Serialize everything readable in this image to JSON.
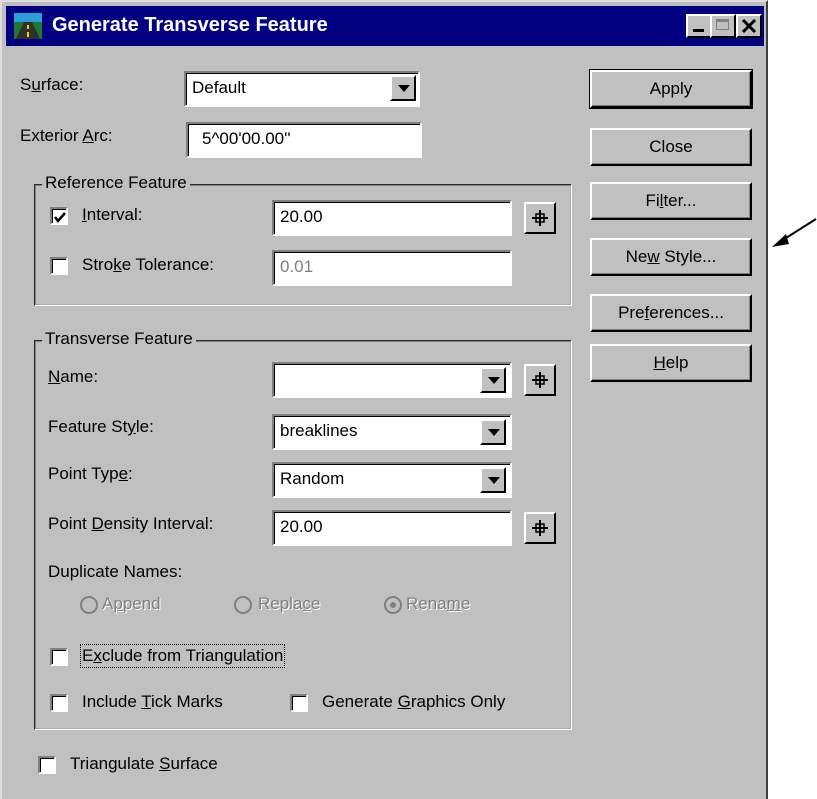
{
  "window": {
    "title": "Generate Transverse Feature"
  },
  "title_icon": "road-icon",
  "surface": {
    "label_pre": "S",
    "label_u": "u",
    "label_post": "rface:",
    "value": "Default"
  },
  "exterior_arc": {
    "label_pre": "Exterior ",
    "label_u": "A",
    "label_post": "rc:",
    "value": "5^00'00.00''"
  },
  "reference": {
    "legend": "Reference Feature",
    "interval": {
      "label_pre": "",
      "label_u": "I",
      "label_post": "nterval:",
      "value": "20.00",
      "checked": true
    },
    "stroke": {
      "label_pre": "Stro",
      "label_u": "k",
      "label_post": "e Tolerance:",
      "value": "0.01",
      "checked": false
    }
  },
  "transverse": {
    "legend": "Transverse Feature",
    "name": {
      "label_pre": "",
      "label_u": "N",
      "label_post": "ame:",
      "value": ""
    },
    "feature_style": {
      "label_pre": "Feature St",
      "label_u": "y",
      "label_post": "le:",
      "value": "breaklines"
    },
    "point_type": {
      "label_pre": "Point Typ",
      "label_u": "e",
      "label_post": ":",
      "value": "Random"
    },
    "density": {
      "label_pre": "Point ",
      "label_u": "D",
      "label_post": "ensity Interval:",
      "value": "20.00"
    },
    "duplicate_label": "Duplicate Names:",
    "append": {
      "label_pre": "A",
      "label_u": "p",
      "label_post": "pend"
    },
    "replace": {
      "label_pre": "Repla",
      "label_u": "c",
      "label_post": "e"
    },
    "rename": {
      "label_pre": "Rena",
      "label_u": "m",
      "label_post": "e",
      "selected": true
    },
    "exclude": {
      "label_pre": "E",
      "label_u": "x",
      "label_post": "clude from Triangulation",
      "checked": false
    },
    "tick": {
      "label_pre": "Include ",
      "label_u": "T",
      "label_post": "ick Marks",
      "checked": false
    },
    "graphics": {
      "label_pre": "Generate ",
      "label_u": "G",
      "label_post": "raphics Only",
      "checked": false
    }
  },
  "triangulate": {
    "label_pre": "Triangulate ",
    "label_u": "S",
    "label_post": "urface",
    "checked": false
  },
  "buttons": {
    "apply": {
      "pre": "Apply",
      "u": "",
      "post": ""
    },
    "close": {
      "pre": "Close",
      "u": "",
      "post": ""
    },
    "filter": {
      "pre": "Fi",
      "u": "l",
      "post": "ter..."
    },
    "new_style": {
      "pre": "Ne",
      "u": "w",
      "post": " Style..."
    },
    "preferences": {
      "pre": "Pre",
      "u": "f",
      "post": "erences..."
    },
    "help": {
      "pre": "",
      "u": "H",
      "post": "elp"
    }
  },
  "colors": {
    "titlebar": "#000080",
    "face": "#c0c0c0"
  }
}
